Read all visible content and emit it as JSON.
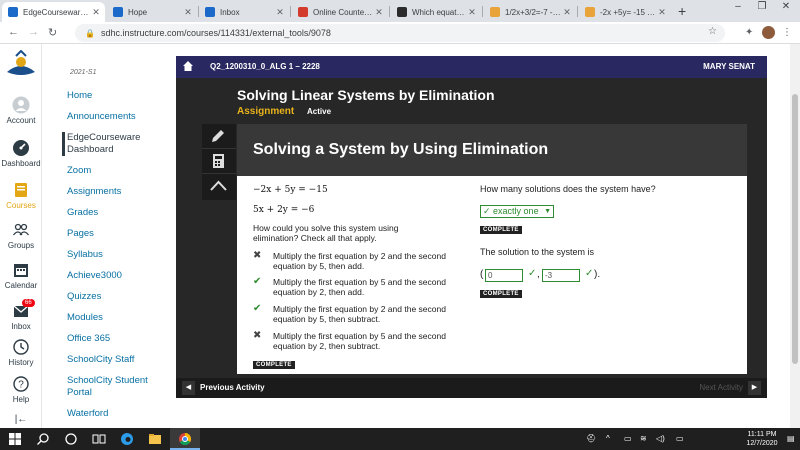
{
  "browser": {
    "tabs": [
      {
        "title": "EdgeCourseware D",
        "color": "#1b6ac9",
        "active": true
      },
      {
        "title": "Hope",
        "color": "#1b6ac9",
        "active": false
      },
      {
        "title": "Inbox",
        "color": "#1b6ac9",
        "active": false
      },
      {
        "title": "Online Counter - S",
        "color": "#d33b2c",
        "active": false
      },
      {
        "title": "Which equation re",
        "color": "#2b2b2b",
        "active": false
      },
      {
        "title": "1/2x+3/2=-7 -3x=",
        "color": "#e8a33a",
        "active": false
      },
      {
        "title": "-2x +5y= -15 5x +",
        "color": "#e8a33a",
        "active": false
      }
    ],
    "new_tab": "+",
    "url": "sdhc.instructure.com/courses/114331/external_tools/9078",
    "window_controls": [
      "–",
      "❐",
      "✕"
    ]
  },
  "global_nav": {
    "items": [
      {
        "label": "Account",
        "icon": "account-icon"
      },
      {
        "label": "Dashboard",
        "icon": "dashboard-icon"
      },
      {
        "label": "Courses",
        "icon": "courses-icon",
        "active": true
      },
      {
        "label": "Groups",
        "icon": "groups-icon"
      },
      {
        "label": "Calendar",
        "icon": "calendar-icon"
      },
      {
        "label": "Inbox",
        "icon": "inbox-icon",
        "badge": "66"
      },
      {
        "label": "History",
        "icon": "history-icon"
      },
      {
        "label": "Help",
        "icon": "help-icon"
      }
    ],
    "collapse": "|←"
  },
  "course_nav": {
    "term": "2021-S1",
    "links": [
      "Home",
      "Announcements",
      "EdgeCourseware Dashboard",
      "Zoom",
      "Assignments",
      "Grades",
      "Pages",
      "Syllabus",
      "Achieve3000",
      "Quizzes",
      "Modules",
      "Office 365",
      "SchoolCity Staff",
      "SchoolCity Student Portal",
      "Waterford"
    ],
    "active_link": "EdgeCourseware Dashboard"
  },
  "edgenuity": {
    "course": "Q2_1200310_0_ALG 1 – 2228",
    "user": "MARY SENAT",
    "activity_title": "Solving Linear Systems by Elimination",
    "activity_type": "Assignment",
    "status": "Active",
    "panel_title": "Solving a System by Using Elimination",
    "equations": [
      "−2x + 5y = −15",
      "5x + 2y = −6"
    ],
    "question1": "How could you solve this system using elimination? Check all that apply.",
    "options": [
      {
        "text": "Multiply the first equation by 2 and the second equation by 5, then add.",
        "mark": "✖",
        "state": "wrong"
      },
      {
        "text": "Multiply the first equation by 5 and the second equation by 2, then add.",
        "mark": "✔",
        "state": "correct"
      },
      {
        "text": "Multiply the first equation by 2 and the second equation by 5, then subtract.",
        "mark": "✔",
        "state": "correct"
      },
      {
        "text": "Multiply the first equation by 5 and the second equation by 2, then subtract.",
        "mark": "✖",
        "state": "wrong"
      }
    ],
    "complete_label": "COMPLETE",
    "question2": "How many solutions does the system have?",
    "answer2": "✓ exactly one",
    "question3": "The solution to the system is",
    "solution_x": "0",
    "solution_y": "-3",
    "check": "✓",
    "prev_label": "Previous Activity",
    "next_label": "Next Activity"
  },
  "taskbar": {
    "clock_time": "11:11 PM",
    "clock_date": "12/7/2020"
  }
}
